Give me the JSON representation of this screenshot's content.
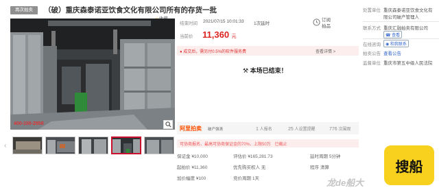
{
  "header": {
    "tag": "再次拍卖",
    "title": "（破）重庆森泰诺亚饮食文化有限公司所有的存货一批",
    "favorite": "收藏"
  },
  "image": {
    "watermark_phone": "400-100-2958",
    "zoom_icon": "search-icon"
  },
  "thumbnails": {
    "prev_icon": "‹",
    "next_icon": "›",
    "count": 5,
    "selected_index": 4
  },
  "auction": {
    "end_time_label": "结束时间",
    "end_time": "2021/07/15 10:01:33",
    "delay": "1次延时",
    "current_price_label": "当前价",
    "current_price": "11,360",
    "currency_unit": "元",
    "remind_line1": "订阅",
    "remind_line2": "拍品",
    "notice_text": "成交后，需另付0.5%的软件服务费",
    "notice_link": "查看详情 >",
    "ended_text": "本场已结束！"
  },
  "platform": {
    "logo": "阿里拍卖",
    "subtitle": "破产强清",
    "stats": [
      {
        "value": "1",
        "label": "人报名"
      },
      {
        "value": "25",
        "label": "人设置提醒"
      },
      {
        "value": "776",
        "label": "次围观"
      }
    ]
  },
  "warning": "可协商报名、最高可协商保证金的70%、上限50万　已截止",
  "details": {
    "rows": [
      [
        {
          "label": "保证金",
          "value": "¥10,000"
        },
        {
          "label": "评估价",
          "value": "¥165,281.73"
        },
        {
          "label": "延时周期",
          "value": "5分钟"
        }
      ],
      [
        {
          "label": "起拍价",
          "value": "¥11,360"
        },
        {
          "label": "优先购买权人",
          "value": "无"
        },
        {
          "label": "程序",
          "value": "清算"
        }
      ],
      [
        {
          "label": "加价幅度",
          "value": "¥100"
        },
        {
          "label": "竞价周期",
          "value": "1天"
        }
      ]
    ]
  },
  "sidebar": {
    "disposal_unit_label": "处置单位",
    "disposal_unit_line1": "重庆森泰诺亚饮食文化有",
    "disposal_unit_line2": "限公司破产管理人",
    "contact_label": "联系方式",
    "contact_value": "重庆汇融拍卖有限公司",
    "contact_phone_chip": "☎ 查看",
    "consult_label": "在线咨询",
    "consult_chip": "和我联系",
    "notice_label": "拍卖公告",
    "notice_value": "查看公告",
    "court_label": "监督单位",
    "court_value": "重庆市第五中级人民法院"
  },
  "overlay": {
    "badge": "搜船",
    "watermark": "龙de船大"
  }
}
